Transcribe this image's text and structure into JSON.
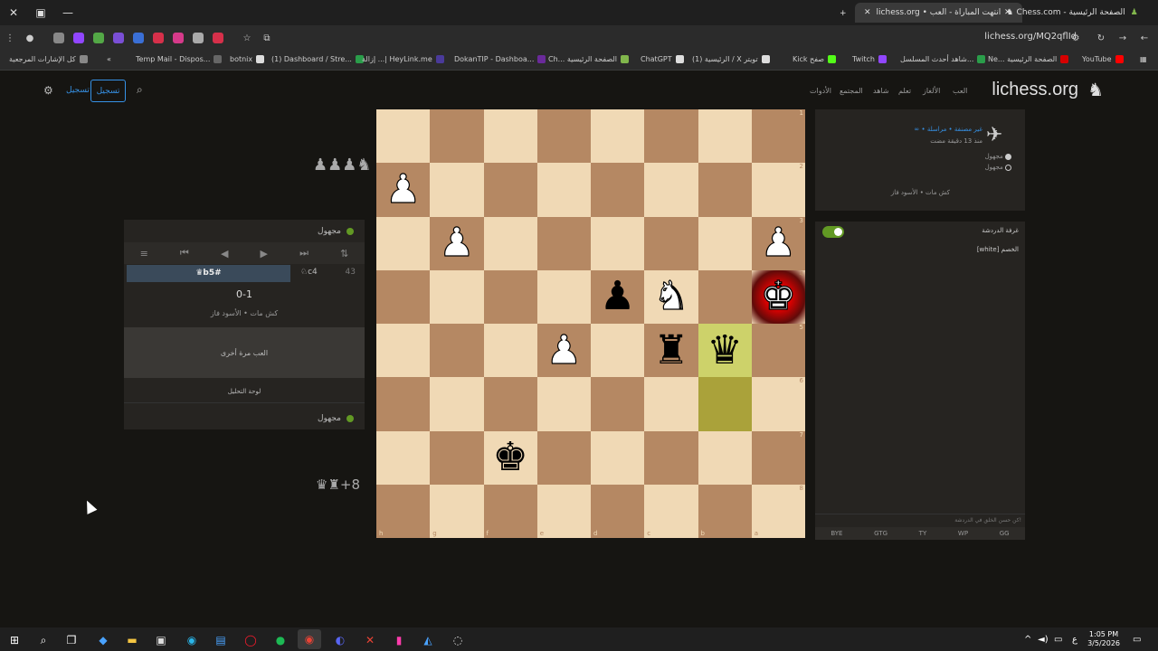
{
  "browser": {
    "tabs": [
      {
        "title": "lichess.org • انتهت المباراة - العب",
        "active": true
      },
      {
        "title": "Chess.com - الصفحة الرئيسية",
        "active": false
      }
    ],
    "url": "lichess.org/MQ2qflId",
    "bookmarks": [
      "كل الإشارات المرجعية",
      "Temp Mail - Dispos...",
      "botnix",
      "(1) Dashboard / Stre...",
      "إزالة ...| HeyLink.me",
      "DokanTIP - Dashboa...",
      "Ch... الصفحة الرئيسية",
      "ChatGPT",
      "(1) الرئيسية / X تويتر",
      "Kick صفح",
      "Twitch",
      "شاهد أحدث المسلسل...",
      "Ne... الصفحة الرئيسية",
      "YouTube"
    ]
  },
  "site": {
    "logo": "lichess.org",
    "nav": [
      "العب",
      "الألغاز",
      "تعلم",
      "شاهد",
      "المجتمع",
      "الأدوات"
    ],
    "signin": "تسجيل",
    "signup_link": "تسجيل"
  },
  "board": {
    "files": [
      "h",
      "g",
      "f",
      "e",
      "d",
      "c",
      "b",
      "a"
    ],
    "ranks": [
      "1",
      "2",
      "3",
      "4",
      "5",
      "6",
      "7",
      "8"
    ],
    "pieces": [
      {
        "square": "h2",
        "glyph": "♟",
        "color": "white"
      },
      {
        "square": "g3",
        "glyph": "♟",
        "color": "white"
      },
      {
        "square": "a3",
        "glyph": "♟",
        "color": "white"
      },
      {
        "square": "d4",
        "glyph": "♟",
        "color": "black"
      },
      {
        "square": "c4",
        "glyph": "♞",
        "color": "white"
      },
      {
        "square": "a4",
        "glyph": "♚",
        "color": "white"
      },
      {
        "square": "e5",
        "glyph": "♟",
        "color": "white"
      },
      {
        "square": "c5",
        "glyph": "♜",
        "color": "black"
      },
      {
        "square": "b5",
        "glyph": "♛",
        "color": "black"
      },
      {
        "square": "f7",
        "glyph": "♚",
        "color": "black"
      }
    ],
    "highlights": [
      "b5",
      "b6"
    ],
    "check": "a4"
  },
  "captured_top": "♟♟♟♞",
  "captured_bottom": "♛♜+8",
  "left_panel": {
    "top_player": "مجهول",
    "bottom_player": "مجهول",
    "move_number": "43",
    "move_white": "♘c4",
    "move_black": "♛b5#",
    "result": "0-1",
    "result_sub": "كش مات • الأسود فاز",
    "rematch": "العب مرة أخرى",
    "analysis": "لوحة التحليل"
  },
  "right_top": {
    "game_info": "∞ • غير مصنفة • مراسلة",
    "time_ago": "منذ 13 دقيقة مضت",
    "player1": "مجهول",
    "player2": "مجهول",
    "status": "كش مات • الأسود فاز"
  },
  "chat": {
    "title": "غرفة الدردشة",
    "message": "[white] الخصم",
    "input_placeholder": "كن حسن الخلق في الدردشة!",
    "presets": [
      "BYE",
      "GTG",
      "TY",
      "WP",
      "GG"
    ]
  },
  "taskbar": {
    "time": "1:05 PM",
    "date": "3/5/2026"
  }
}
